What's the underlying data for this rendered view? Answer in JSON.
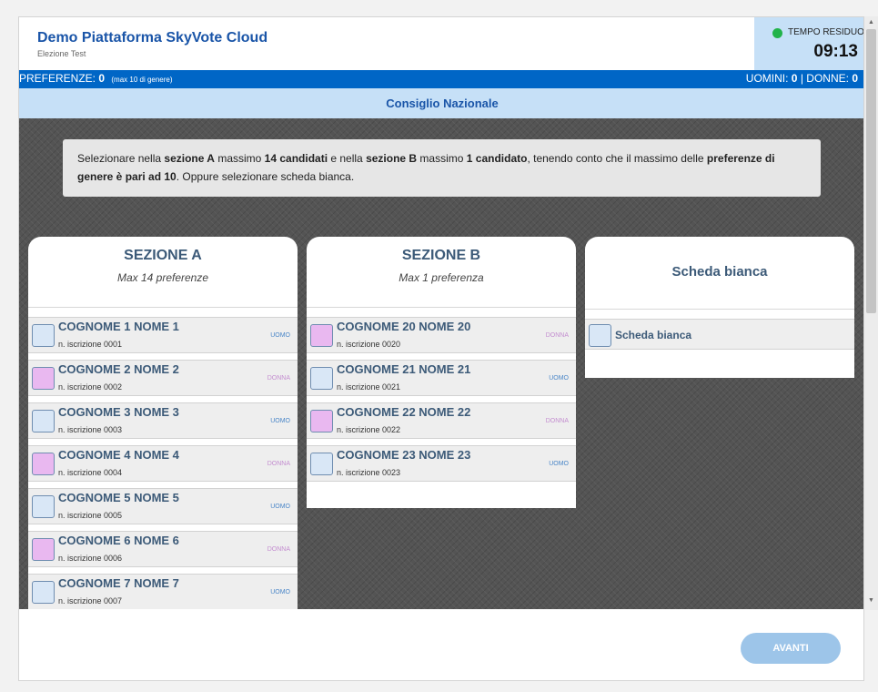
{
  "header": {
    "title": "Demo Piattaforma SkyVote Cloud",
    "subtitle": "Elezione Test"
  },
  "timer": {
    "label": "TEMPO RESIDUO",
    "value": "09:13",
    "status_color": "#22b34a"
  },
  "preferences": {
    "label": "PREFERENZE:",
    "count": "0",
    "note": "(max 10 di genere)",
    "men_label": "UOMINI:",
    "men_count": "0",
    "separator": "|",
    "women_label": "DONNE:",
    "women_count": "0"
  },
  "organ": "Consiglio Nazionale",
  "instructions": {
    "p1": "Selezionare nella ",
    "b1": "sezione A",
    "p2": " massimo ",
    "b2": "14 candidati",
    "p3": " e nella ",
    "b3": "sezione B",
    "p4": " massimo ",
    "b4": "1 candidato",
    "p5": ", tenendo conto che il massimo delle ",
    "b5": "preferenze di genere è pari ad 10",
    "p6": ". Oppure selezionare scheda bianca."
  },
  "section_a": {
    "title": "SEZIONE A",
    "subtitle": "Max 14 preferenze",
    "candidates": [
      {
        "name": "COGNOME 1 NOME 1",
        "reg": "n. iscrizione 0001",
        "gender": "UOMO",
        "type": "uomo"
      },
      {
        "name": "COGNOME 2 NOME 2",
        "reg": "n. iscrizione 0002",
        "gender": "DONNA",
        "type": "donna"
      },
      {
        "name": "COGNOME 3 NOME 3",
        "reg": "n. iscrizione 0003",
        "gender": "UOMO",
        "type": "uomo"
      },
      {
        "name": "COGNOME 4 NOME 4",
        "reg": "n. iscrizione 0004",
        "gender": "DONNA",
        "type": "donna"
      },
      {
        "name": "COGNOME 5 NOME 5",
        "reg": "n. iscrizione 0005",
        "gender": "UOMO",
        "type": "uomo"
      },
      {
        "name": "COGNOME 6 NOME 6",
        "reg": "n. iscrizione 0006",
        "gender": "DONNA",
        "type": "donna"
      },
      {
        "name": "COGNOME 7 NOME 7",
        "reg": "n. iscrizione 0007",
        "gender": "UOMO",
        "type": "uomo"
      }
    ]
  },
  "section_b": {
    "title": "SEZIONE B",
    "subtitle": "Max 1 preferenza",
    "candidates": [
      {
        "name": "COGNOME 20 NOME 20",
        "reg": "n. iscrizione 0020",
        "gender": "DONNA",
        "type": "donna"
      },
      {
        "name": "COGNOME 21 NOME 21",
        "reg": "n. iscrizione 0021",
        "gender": "UOMO",
        "type": "uomo"
      },
      {
        "name": "COGNOME 22 NOME 22",
        "reg": "n. iscrizione 0022",
        "gender": "DONNA",
        "type": "donna"
      },
      {
        "name": "COGNOME 23 NOME 23",
        "reg": "n. iscrizione 0023",
        "gender": "UOMO",
        "type": "uomo"
      }
    ]
  },
  "blank": {
    "title": "Scheda bianca",
    "option_label": "Scheda bianca"
  },
  "footer": {
    "next_label": "AVANTI"
  },
  "icons": {
    "scroll_up": "scroll-up-arrow-icon",
    "scroll_down": "scroll-down-arrow-icon",
    "status": "status-dot-icon"
  }
}
